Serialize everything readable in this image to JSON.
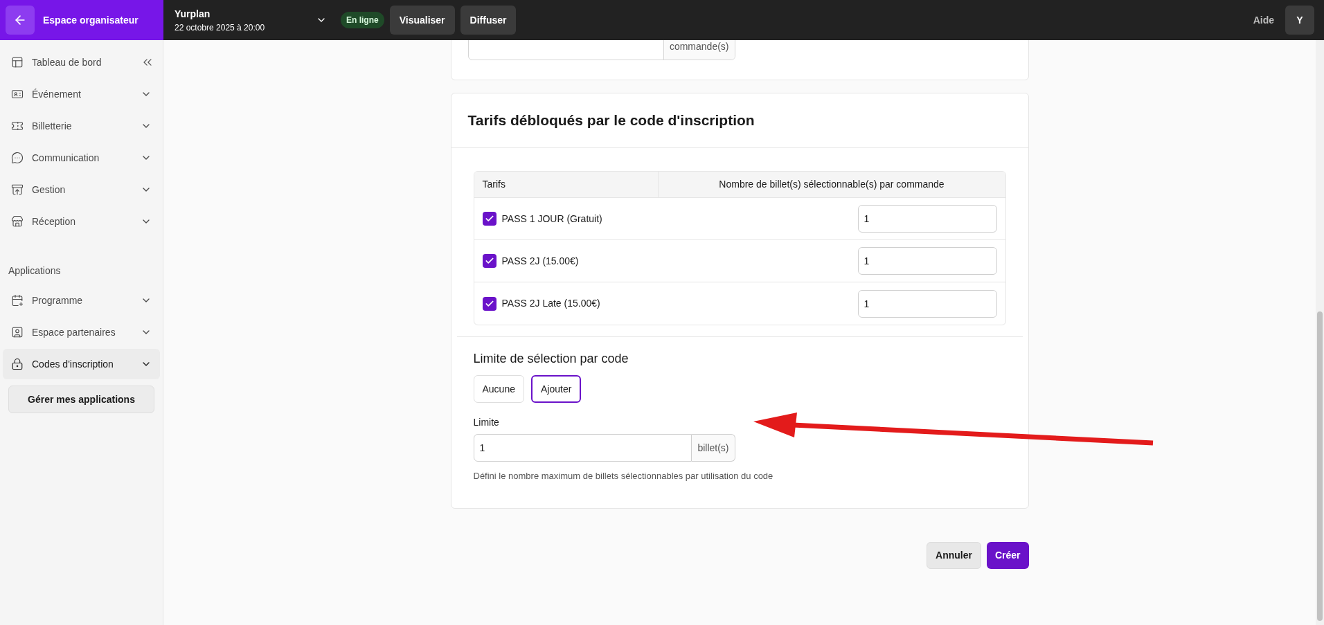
{
  "topbar": {
    "back_label": "Espace organisateur",
    "event_name": "Yurplan",
    "event_date": "22 octobre 2025 à 20:00",
    "status": "En ligne",
    "actions": [
      "Visualiser",
      "Diffuser"
    ],
    "help": "Aide",
    "avatar": "Y"
  },
  "sidebar": {
    "main_items": [
      {
        "label": "Tableau de bord",
        "kind": "link",
        "selected": false
      },
      {
        "label": "Événement",
        "kind": "group",
        "selected": false
      },
      {
        "label": "Billetterie",
        "kind": "group",
        "selected": false
      },
      {
        "label": "Communication",
        "kind": "group",
        "selected": false
      },
      {
        "label": "Gestion",
        "kind": "group",
        "selected": false
      },
      {
        "label": "Réception",
        "kind": "group",
        "selected": false
      }
    ],
    "section_title": "Applications",
    "app_items": [
      {
        "label": "Programme",
        "kind": "group",
        "selected": false
      },
      {
        "label": "Espace partenaires",
        "kind": "group",
        "selected": false
      },
      {
        "label": "Codes d'inscription",
        "kind": "group",
        "selected": true
      }
    ],
    "manage_button": "Gérer mes applications"
  },
  "previous_card": {
    "addon": "commande(s)"
  },
  "tarifs_card": {
    "title": "Tarifs débloqués par le code d'inscription",
    "columns": [
      "Tarifs",
      "Nombre de billet(s) sélectionnable(s) par commande"
    ],
    "rows": [
      {
        "label": "PASS 1 JOUR (Gratuit)",
        "checked": true,
        "value": "1"
      },
      {
        "label": "PASS 2J (15.00€)",
        "checked": true,
        "value": "1"
      },
      {
        "label": "PASS 2J Late (15.00€)",
        "checked": true,
        "value": "1"
      }
    ],
    "limit_title": "Limite de sélection par code",
    "limit_options": [
      {
        "label": "Aucune",
        "selected": false
      },
      {
        "label": "Ajouter",
        "selected": true
      }
    ],
    "limit_label": "Limite",
    "limit_value": "1",
    "limit_addon": "billet(s)",
    "limit_help": "Défini le nombre maximum de billets sélectionnables par utilisation du code"
  },
  "footer": {
    "cancel": "Annuler",
    "create": "Créer"
  }
}
